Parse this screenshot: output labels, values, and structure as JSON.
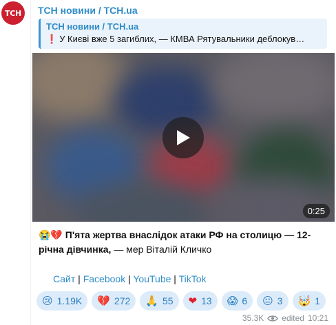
{
  "avatar": {
    "label": "ТСН",
    "color": "#cc1f2f"
  },
  "sender": "ТСН новини / TCH.ua",
  "reply": {
    "title": "ТСН новини / TCH.ua",
    "mark": "❗",
    "text": "У Києві вже 5 загиблих, — КМВА Рятувальники деблокув…"
  },
  "media": {
    "duration": "0:25"
  },
  "message": {
    "emoji": "😭💔",
    "bold": "П'ята жертва внаслідок атаки РФ на столицю — 12-річна дівчинка,",
    "rest": " — мер Віталій Кличко"
  },
  "links": {
    "site": "Сайт",
    "sep": " | ",
    "facebook": "Facebook",
    "youtube": "YouTube",
    "tiktok": "TikTok"
  },
  "reactions": [
    {
      "emoji": "😢",
      "count": "1.19K"
    },
    {
      "emoji": "💔",
      "count": "272"
    },
    {
      "emoji": "🙏",
      "count": "55"
    },
    {
      "emoji": "❤",
      "count": "13"
    },
    {
      "emoji": "😱",
      "count": "6"
    },
    {
      "emoji": "😐",
      "count": "3"
    },
    {
      "emoji": "🤯",
      "count": "1"
    }
  ],
  "meta": {
    "views": "35.3K",
    "edited": "edited",
    "time": "10:21"
  }
}
